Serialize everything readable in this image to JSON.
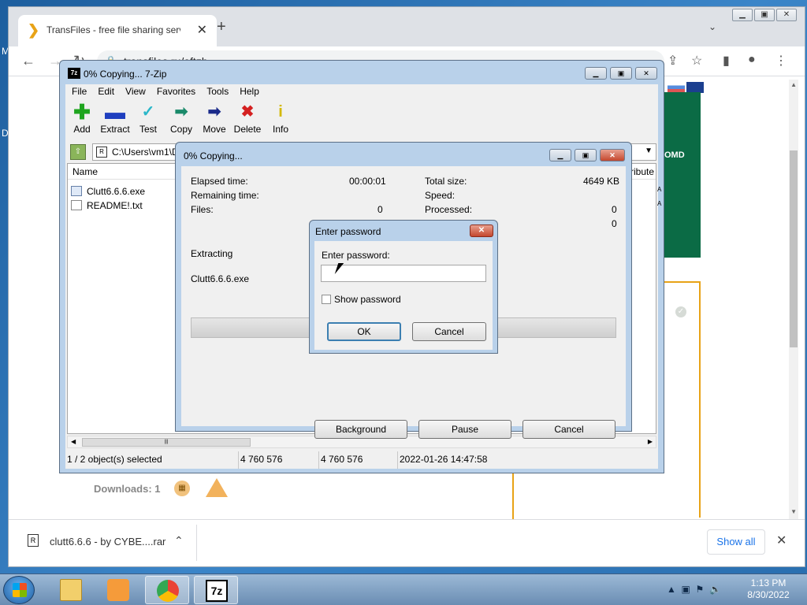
{
  "desktop": {
    "left_letter_1": "M",
    "left_letter_2": "D"
  },
  "browser": {
    "tab_title": "TransFiles - free file sharing servi",
    "tab_close": "✕",
    "new_tab": "+",
    "url": "transfiles.ru/aftzb",
    "page_badge": "OMD",
    "downloads_label": "Downloads: 1"
  },
  "download_shelf": {
    "file_name": "clutt6.6.6 - by CYBE....rar",
    "show_all": "Show all",
    "close": "✕"
  },
  "zip": {
    "title": "0% Copying... 7-Zip",
    "menu": [
      "File",
      "Edit",
      "View",
      "Favorites",
      "Tools",
      "Help"
    ],
    "tools": [
      {
        "label": "Add",
        "icon": "add-icon",
        "color": "#1fa51f"
      },
      {
        "label": "Extract",
        "icon": "extract-icon",
        "color": "#1f3fbf"
      },
      {
        "label": "Test",
        "icon": "test-icon",
        "color": "#2bb7c9"
      },
      {
        "label": "Copy",
        "icon": "copy-icon",
        "color": "#1a8a6a"
      },
      {
        "label": "Move",
        "icon": "move-icon",
        "color": "#1a2a8a"
      },
      {
        "label": "Delete",
        "icon": "delete-icon",
        "color": "#d42020"
      },
      {
        "label": "Info",
        "icon": "info-icon",
        "color": "#d4b800"
      }
    ],
    "address": "C:\\Users\\vm1\\D",
    "columns": {
      "name": "Name",
      "attributes": "ttribute"
    },
    "files": [
      {
        "name": "Clutt6.6.6.exe",
        "attr": "A"
      },
      {
        "name": "README!.txt",
        "attr": "A"
      }
    ],
    "status": {
      "selected": "1 / 2 object(s) selected",
      "size": "4 760 576",
      "packed": "4 760 576",
      "modified": "2022-01-26 14:47:58"
    }
  },
  "progress": {
    "title": "0% Copying...",
    "elapsed_label": "Elapsed time:",
    "elapsed_value": "00:00:01",
    "remaining_label": "Remaining time:",
    "files_label": "Files:",
    "files_value": "0",
    "total_label": "Total size:",
    "total_value": "4649 KB",
    "speed_label": "Speed:",
    "processed_label": "Processed:",
    "processed_value": "0",
    "extra_value": "0",
    "operation": "Extracting",
    "current_file": "Clutt6.6.6.exe",
    "percent": 0,
    "background_btn": "Background",
    "pause_btn": "Pause",
    "cancel_btn": "Cancel"
  },
  "password": {
    "title": "Enter password",
    "label": "Enter password:",
    "value": "",
    "show_label": "Show password",
    "ok": "OK",
    "cancel": "Cancel"
  },
  "taskbar": {
    "time": "1:13 PM",
    "date": "8/30/2022"
  }
}
